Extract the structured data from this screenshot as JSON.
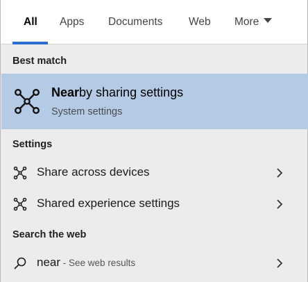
{
  "tabs": [
    {
      "label": "All",
      "active": true
    },
    {
      "label": "Apps",
      "active": false
    },
    {
      "label": "Documents",
      "active": false
    },
    {
      "label": "Web",
      "active": false
    },
    {
      "label": "More",
      "active": false
    }
  ],
  "accent_color": "#2b6ed1",
  "highlight_color": "#b5cbe5",
  "best_match": {
    "heading": "Best match",
    "title_bold": "Near",
    "title_rest": "by sharing settings",
    "subtitle": "System settings",
    "icon": "nearby-sharing-icon"
  },
  "settings": {
    "heading": "Settings",
    "items": [
      {
        "label": "Share across devices",
        "icon": "nearby-sharing-icon"
      },
      {
        "label": "Shared experience settings",
        "icon": "nearby-sharing-icon"
      }
    ]
  },
  "web": {
    "heading": "Search the web",
    "query": "near",
    "hint": " - See web results",
    "icon": "search-icon"
  }
}
